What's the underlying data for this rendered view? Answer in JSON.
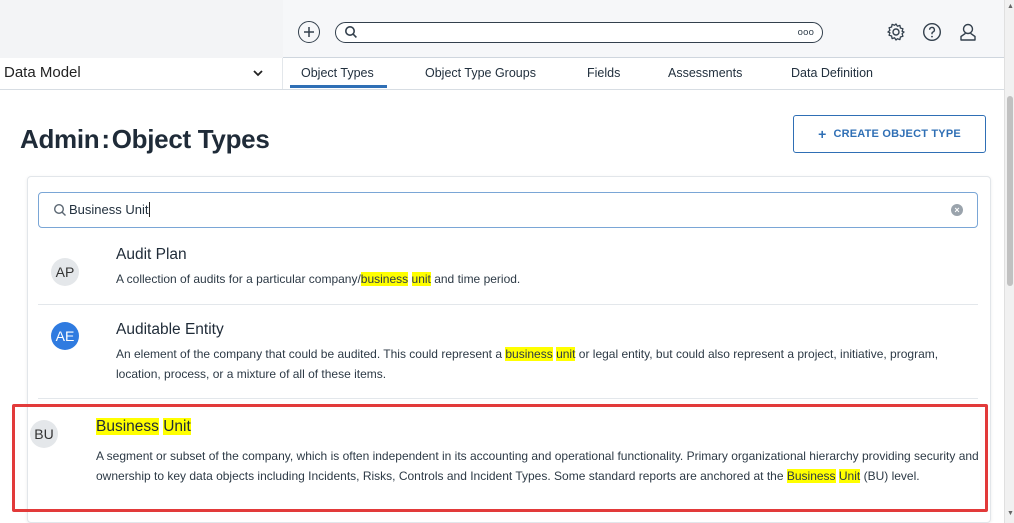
{
  "topbar": {
    "add_icon": "plus-circle-icon",
    "search_icon": "search-icon",
    "more_label": "ooo",
    "settings_icon": "gear-icon",
    "help_icon": "question-icon",
    "user_icon": "user-icon"
  },
  "navbar": {
    "module": "Data Model",
    "tabs": [
      {
        "label": "Object Types",
        "active": true
      },
      {
        "label": "Object Type Groups",
        "active": false
      },
      {
        "label": "Fields",
        "active": false
      },
      {
        "label": "Assessments",
        "active": false
      },
      {
        "label": "Data Definition",
        "active": false
      }
    ]
  },
  "header": {
    "title_prefix": "Admin",
    "title_sep": ":",
    "title": "Object Types",
    "create_button": "CREATE OBJECT TYPE"
  },
  "search": {
    "value": "Business Unit"
  },
  "results": [
    {
      "initials": "AP",
      "avatar_color": "#e4e7ea",
      "title": "Audit Plan",
      "desc": {
        "p1": "A collection of audits for a particular company/",
        "h1": "business",
        "p2": " ",
        "h2": "unit",
        "p3": " and time period."
      }
    },
    {
      "initials": "AE",
      "avatar_color": "#2f7be0",
      "title": "Auditable Entity",
      "desc": {
        "p1": "An element of the company that could be audited. This could represent a ",
        "h1": "business",
        "p2": " ",
        "h2": "unit",
        "p3": " or legal entity, but could also represent a project, initiative, program, location, process, or a mixture of all of these items."
      }
    },
    {
      "initials": "BU",
      "avatar_color": "#e4e7ea",
      "title_h1": "Business",
      "title_h2": "Unit",
      "desc": {
        "p1": "A segment or subset of the company, which is often independent in its accounting and operational functionality. Primary organizational hierarchy providing security and ownership to key data objects including Incidents, Risks, Controls and Incident Types. Some standard reports are anchored at the ",
        "h1": "Business",
        "p2": " ",
        "h2": "Unit",
        "p3": " (BU) level."
      }
    }
  ],
  "colors": {
    "accent": "#2f6fb5",
    "highlight": "#ffff00",
    "callout": "#e23a3a"
  }
}
